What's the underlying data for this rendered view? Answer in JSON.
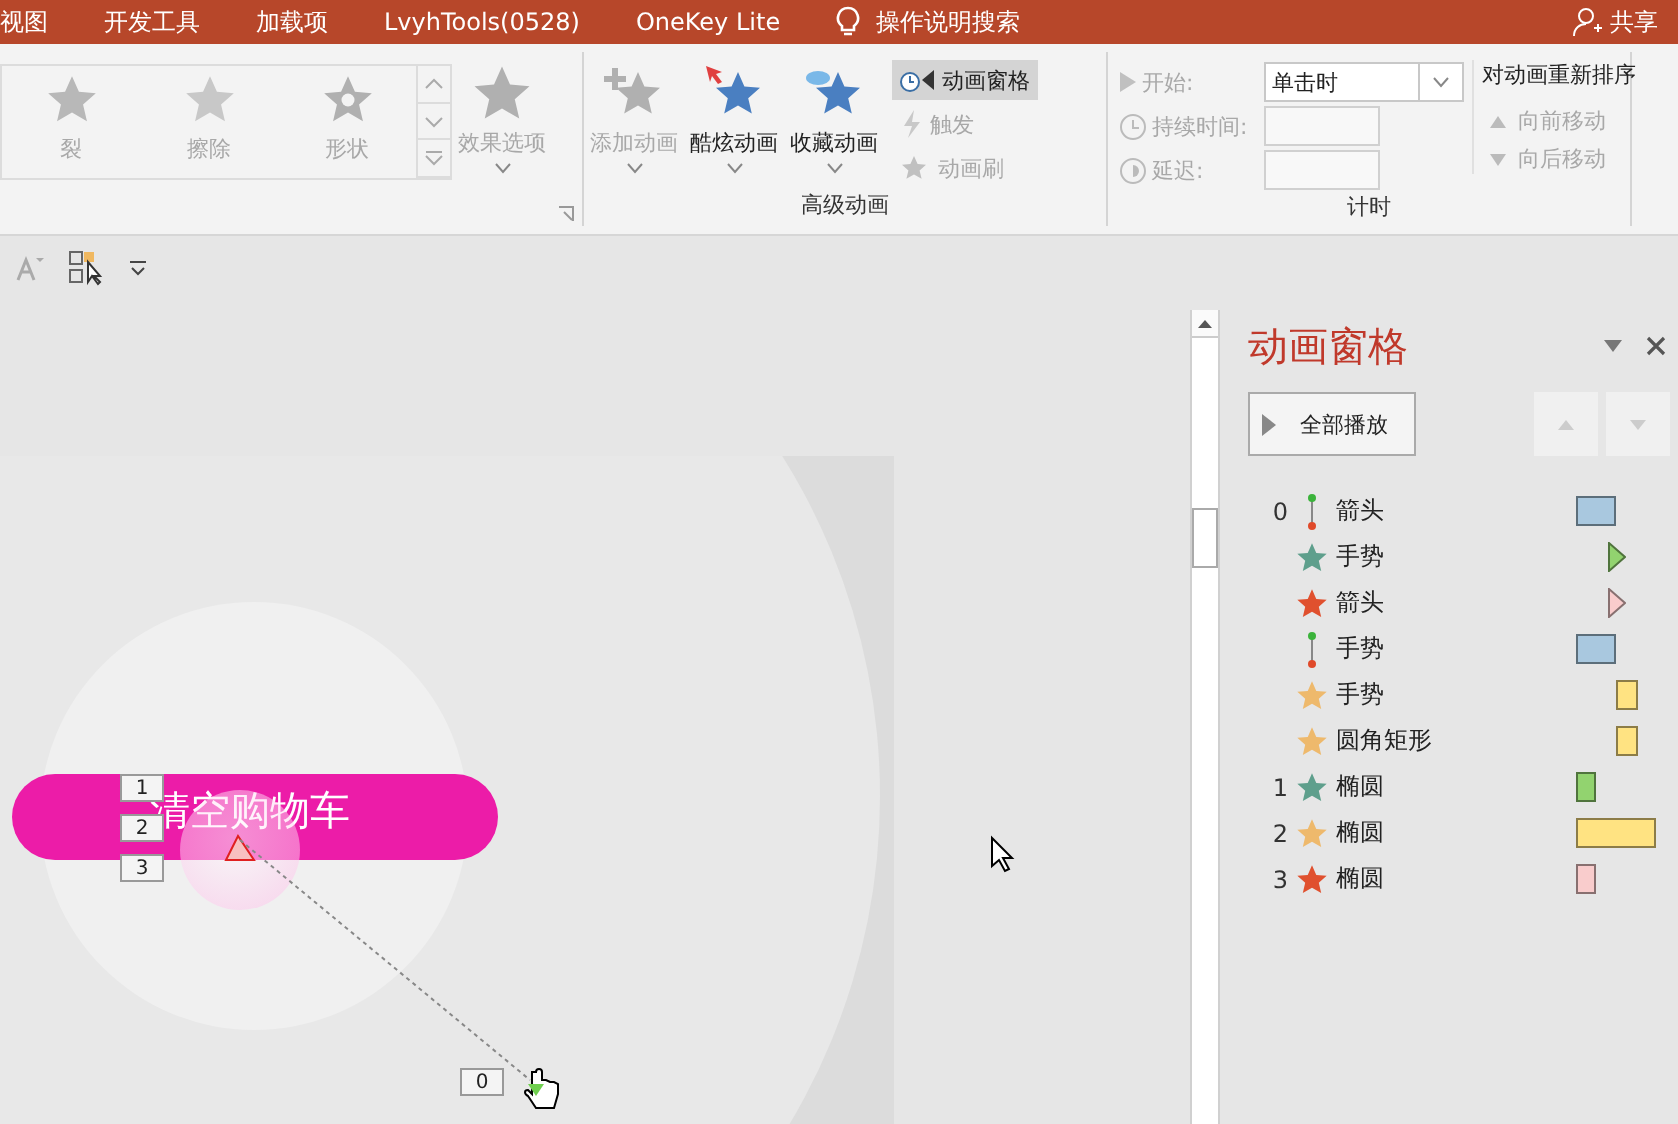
{
  "menu_tabs": [
    {
      "label": "视图"
    },
    {
      "label": "开发工具"
    },
    {
      "label": "加载项"
    },
    {
      "label": "LvyhTools(0528)"
    },
    {
      "label": "OneKey Lite"
    }
  ],
  "tell_me": {
    "label": "操作说明搜索"
  },
  "share": {
    "label": "共享"
  },
  "ribbon": {
    "gallery": [
      {
        "label": "裂",
        "kind": "split"
      },
      {
        "label": "擦除",
        "kind": "wipe"
      },
      {
        "label": "形状",
        "kind": "shape"
      }
    ],
    "effect_options": {
      "label": "效果选项",
      "disabled": true
    },
    "advanced": {
      "title": "高级动画",
      "large_buttons": [
        {
          "label": "添加动画",
          "kind": "add",
          "disabled": true
        },
        {
          "label": "酷炫动画",
          "kind": "cool",
          "disabled": false
        },
        {
          "label": "收藏动画",
          "kind": "favorite",
          "disabled": false
        }
      ],
      "small_buttons": [
        {
          "label": "动画窗格",
          "kind": "pane",
          "selected": true,
          "disabled": false
        },
        {
          "label": "触发",
          "kind": "trigger",
          "selected": false,
          "disabled": true
        },
        {
          "label": "动画刷",
          "kind": "painter",
          "selected": false,
          "disabled": true
        }
      ]
    },
    "timing": {
      "title": "计时",
      "start": {
        "label": "开始:",
        "value": "单击时"
      },
      "duration": {
        "label": "持续时间:"
      },
      "delay": {
        "label": "延迟:"
      },
      "reorder": {
        "title": "对动画重新排序",
        "buttons": [
          {
            "label": "向前移动",
            "kind": "up"
          },
          {
            "label": "向后移动",
            "kind": "down"
          }
        ]
      }
    }
  },
  "slide": {
    "button_text": "清空购物车",
    "order_tags": [
      {
        "label": "1"
      },
      {
        "label": "2"
      },
      {
        "label": "3"
      }
    ],
    "path_tag": {
      "label": "0"
    }
  },
  "pane": {
    "title": "动画窗格",
    "play_all": {
      "label": "全部播放"
    },
    "items": [
      {
        "order": "0",
        "effect": {
          "kind": "path"
        },
        "name": "箭头",
        "bar": {
          "kind": "block",
          "color": "#a9c8df"
        }
      },
      {
        "effect": {
          "kind": "star",
          "color": "#5e9f8c"
        },
        "name": "手势",
        "bar": {
          "kind": "arrow",
          "color": "#92d36f"
        }
      },
      {
        "effect": {
          "kind": "star",
          "color": "#e0502e"
        },
        "name": "箭头",
        "bar": {
          "kind": "arrow",
          "color": "#f9cccc"
        }
      },
      {
        "effect": {
          "kind": "path"
        },
        "name": "手势",
        "bar": {
          "kind": "block",
          "color": "#a9c8df"
        }
      },
      {
        "effect": {
          "kind": "star",
          "color": "#eeb96c"
        },
        "name": "手势",
        "bar": {
          "kind": "late",
          "color": "#ffe382"
        }
      },
      {
        "effect": {
          "kind": "star",
          "color": "#eeb96c"
        },
        "name": "圆角矩形",
        "bar": {
          "kind": "late",
          "color": "#ffe382"
        }
      },
      {
        "order": "1",
        "effect": {
          "kind": "star",
          "color": "#5e9f8c"
        },
        "name": "椭圆",
        "bar": {
          "kind": "narrow",
          "color": "#92d36f"
        }
      },
      {
        "order": "2",
        "effect": {
          "kind": "star",
          "color": "#eeb96c"
        },
        "name": "椭圆",
        "bar": {
          "kind": "wide",
          "color": "#ffe382"
        }
      },
      {
        "order": "3",
        "effect": {
          "kind": "star",
          "color": "#e0502e"
        },
        "name": "椭圆",
        "bar": {
          "kind": "narrow",
          "color": "#f9cccc"
        }
      }
    ]
  }
}
